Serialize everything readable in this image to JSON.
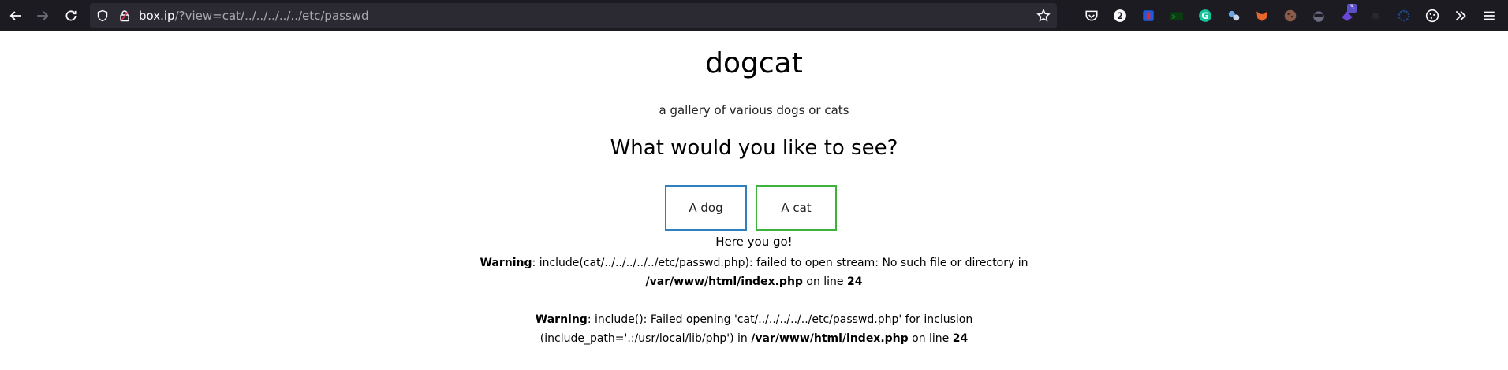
{
  "browser": {
    "url_host": "box.ip",
    "url_path": "/?view=cat/../../../../../etc/passwd",
    "badges": {
      "pocket_count": "2",
      "ext_count": "3"
    }
  },
  "page": {
    "title": "dogcat",
    "subtitle": "a gallery of various dogs or cats",
    "question": "What would you like to see?",
    "buttons": {
      "dog": "A dog",
      "cat": "A cat"
    },
    "result": "Here you go!",
    "warning1": {
      "label": "Warning",
      "text": ": include(cat/../../../../../etc/passwd.php): failed to open stream: No such file or directory in ",
      "file": "/var/www/html/index.php",
      "line_label": " on line ",
      "line": "24"
    },
    "warning2": {
      "label": "Warning",
      "text": ": include(): Failed opening 'cat/../../../../../etc/passwd.php' for inclusion (include_path='.:/usr/local/lib/php') in ",
      "file": "/var/www/html/index.php",
      "line_label": " on line ",
      "line": "24"
    }
  },
  "colors": {
    "toolbar": "#1c1b22",
    "urlbar": "#2b2a33",
    "dog_border": "#2f7fc1",
    "cat_border": "#3db33d"
  }
}
